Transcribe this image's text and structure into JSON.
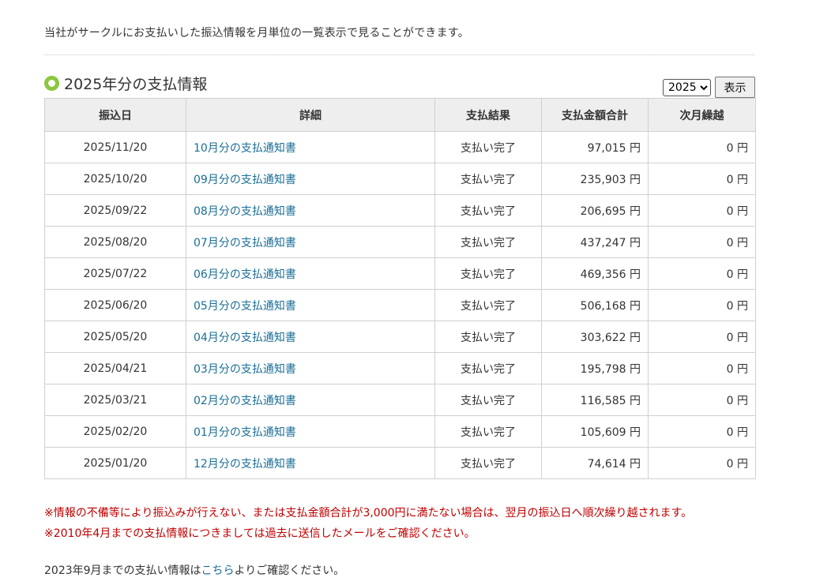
{
  "intro": "当社がサークルにお支払いした振込情報を月単位の一覧表示で見ることができます。",
  "section": {
    "title": "2025年分の支払情報",
    "year_selected": "2025",
    "show_label": "表示"
  },
  "table": {
    "headers": [
      "振込日",
      "詳細",
      "支払結果",
      "支払金額合計",
      "次月繰越"
    ],
    "rows": [
      {
        "date": "2025/11/20",
        "detail": "10月分の支払通知書",
        "result": "支払い完了",
        "amount": "97,015 円",
        "carry": "0 円"
      },
      {
        "date": "2025/10/20",
        "detail": "09月分の支払通知書",
        "result": "支払い完了",
        "amount": "235,903 円",
        "carry": "0 円"
      },
      {
        "date": "2025/09/22",
        "detail": "08月分の支払通知書",
        "result": "支払い完了",
        "amount": "206,695 円",
        "carry": "0 円"
      },
      {
        "date": "2025/08/20",
        "detail": "07月分の支払通知書",
        "result": "支払い完了",
        "amount": "437,247 円",
        "carry": "0 円"
      },
      {
        "date": "2025/07/22",
        "detail": "06月分の支払通知書",
        "result": "支払い完了",
        "amount": "469,356 円",
        "carry": "0 円"
      },
      {
        "date": "2025/06/20",
        "detail": "05月分の支払通知書",
        "result": "支払い完了",
        "amount": "506,168 円",
        "carry": "0 円"
      },
      {
        "date": "2025/05/20",
        "detail": "04月分の支払通知書",
        "result": "支払い完了",
        "amount": "303,622 円",
        "carry": "0 円"
      },
      {
        "date": "2025/04/21",
        "detail": "03月分の支払通知書",
        "result": "支払い完了",
        "amount": "195,798 円",
        "carry": "0 円"
      },
      {
        "date": "2025/03/21",
        "detail": "02月分の支払通知書",
        "result": "支払い完了",
        "amount": "116,585 円",
        "carry": "0 円"
      },
      {
        "date": "2025/02/20",
        "detail": "01月分の支払通知書",
        "result": "支払い完了",
        "amount": "105,609 円",
        "carry": "0 円"
      },
      {
        "date": "2025/01/20",
        "detail": "12月分の支払通知書",
        "result": "支払い完了",
        "amount": "74,614 円",
        "carry": "0 円"
      }
    ]
  },
  "notes": [
    "※情報の不備等により振込みが行えない、または支払金額合計が3,000円に満たない場合は、翌月の振込日へ順次繰り越されます。",
    "※2010年4月までの支払情報につきましては過去に送信したメールをご確認ください。"
  ],
  "footer": {
    "before": "2023年9月までの支払い情報は",
    "link": "こちら",
    "after": "よりご確認ください。"
  },
  "colors": {
    "accent_ring": "#8cc63f",
    "link": "#1a6e96",
    "note": "#c00000",
    "header_bg": "#eeeeee"
  }
}
